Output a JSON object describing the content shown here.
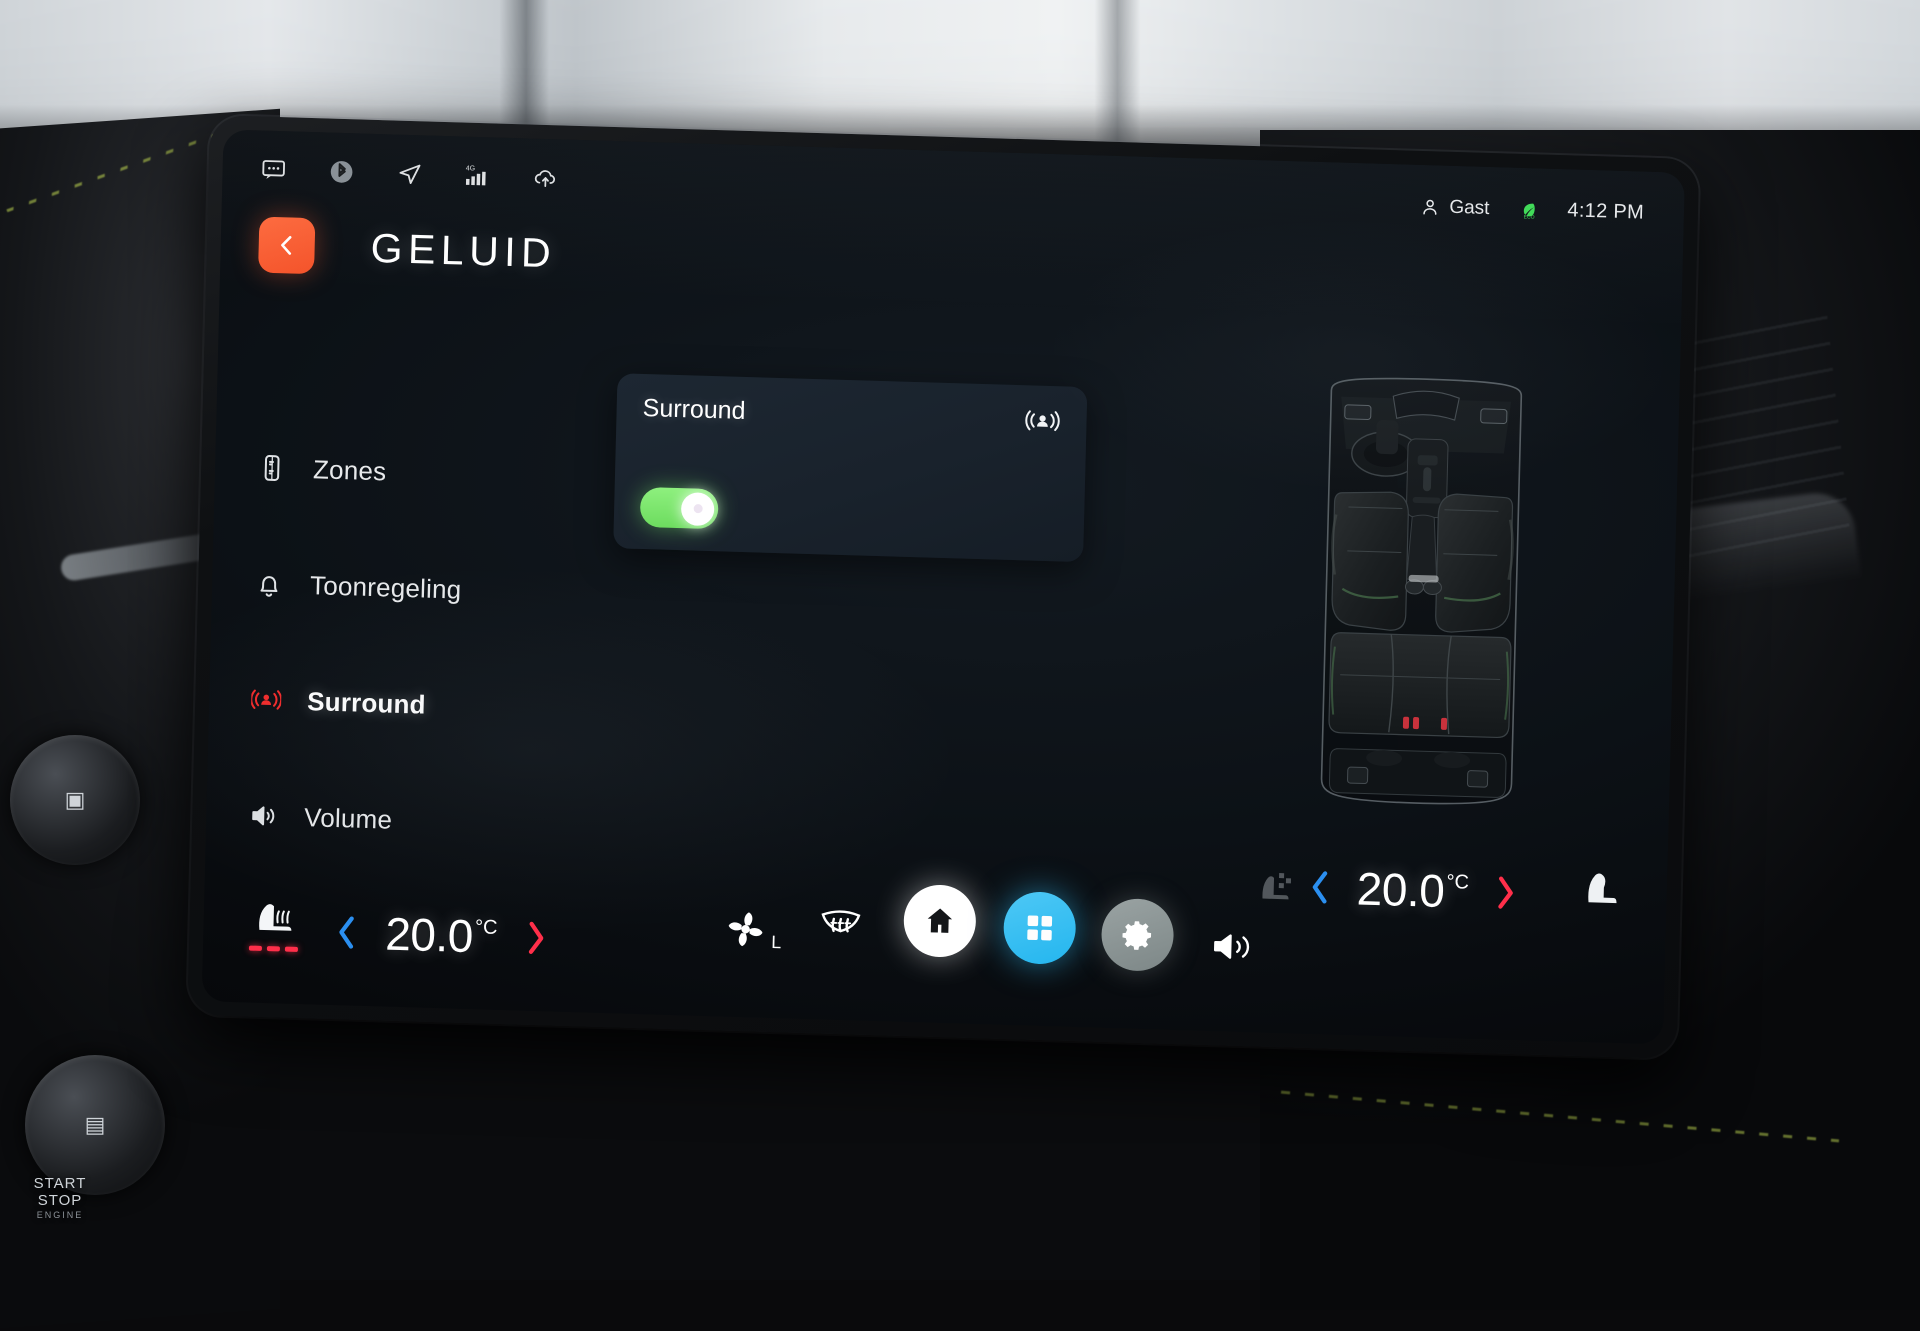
{
  "statusbar": {
    "icons": [
      {
        "name": "message-icon",
        "label": "Messages"
      },
      {
        "name": "bluetooth-icon",
        "label": "Bluetooth"
      },
      {
        "name": "navigation-icon",
        "label": "Navigation"
      },
      {
        "name": "signal-4g-icon",
        "label": "4G"
      },
      {
        "name": "cloud-upload-icon",
        "label": "Cloud"
      }
    ],
    "signal_label": "4G",
    "user": "Gast",
    "eco_badge": "ECO",
    "clock": "4:12 PM"
  },
  "header": {
    "back_label": "Back",
    "title": "GELUID"
  },
  "sidebar": {
    "items": [
      {
        "label": "Zones",
        "icon": "fader-icon",
        "active": false
      },
      {
        "label": "Toonregeling",
        "icon": "bell-icon",
        "active": false
      },
      {
        "label": "Surround",
        "icon": "surround-icon",
        "active": true
      },
      {
        "label": "Volume",
        "icon": "speaker-icon",
        "active": false
      }
    ]
  },
  "card": {
    "title": "Surround",
    "icon": "surround-person-icon",
    "toggle_on": true,
    "toggle_state_label": "On"
  },
  "diagram": {
    "name": "car-interior-top-view",
    "description": "Top view of vehicle cabin with two front seats, center console and rear bench"
  },
  "climate": {
    "left": {
      "seat_heat_icon": "heated-seat-icon",
      "seat_heat_level": 3,
      "prev_label": "‹",
      "temperature": "20.0",
      "unit": "°C",
      "next_label": "›"
    },
    "right": {
      "seat_heat_icon": "heated-seat-icon-dim",
      "prev_label": "‹",
      "temperature": "20.0",
      "unit": "°C",
      "next_label": "›",
      "seat_icon": "seat-icon"
    },
    "fan": {
      "icon": "fan-icon",
      "level_label": "L"
    },
    "defrost": {
      "icon": "defrost-icon"
    },
    "buttons": [
      {
        "name": "home-button",
        "icon": "home-icon",
        "color": "#ffffff"
      },
      {
        "name": "apps-button",
        "icon": "grid-icon",
        "color": "#2ab9f0"
      },
      {
        "name": "settings-button",
        "icon": "gear-icon",
        "color": "#8b9494"
      }
    ],
    "volume": {
      "icon": "volume-icon"
    }
  },
  "colors": {
    "accent_orange": "#f4532a",
    "toggle_green": "#7ee87e",
    "apps_blue": "#2ab9f0",
    "gear_grey": "#8b9494",
    "chevron_cold": "#2b8ff0",
    "chevron_hot": "#ff2f4a",
    "card_bg": "#1b2430",
    "screen_bg": "#0a0e13"
  },
  "dashboard": {
    "start_stop_line1": "START",
    "start_stop_line2": "STOP",
    "start_stop_line3": "ENGINE"
  }
}
